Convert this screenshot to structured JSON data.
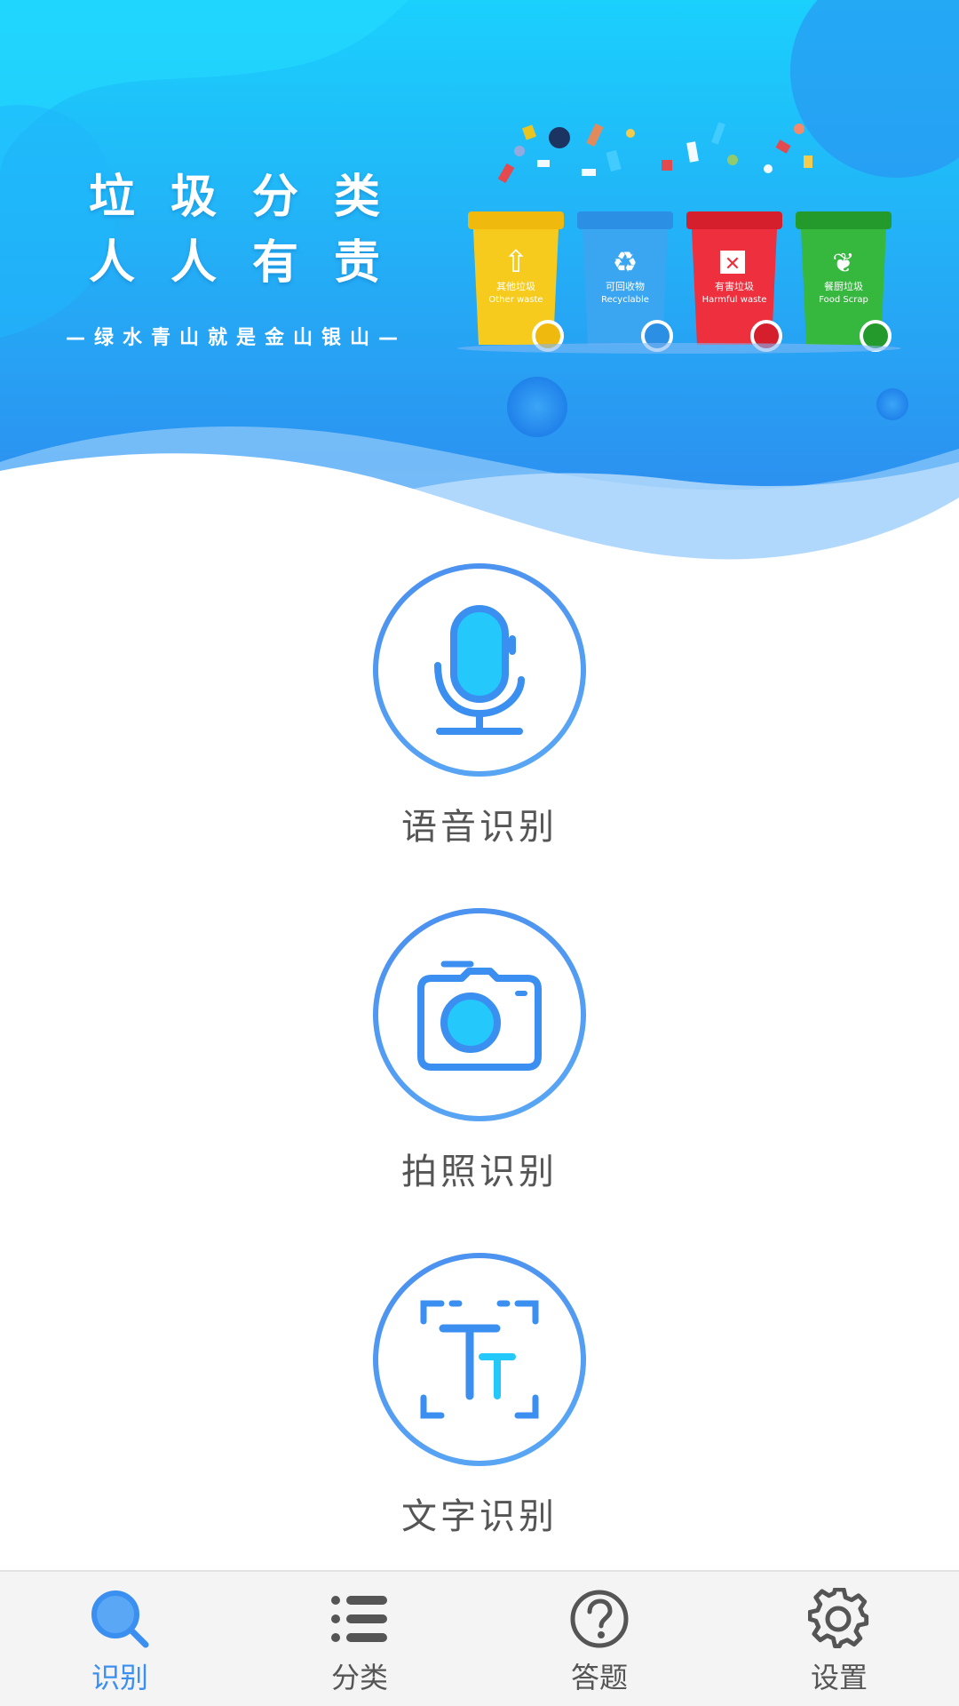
{
  "banner": {
    "slogan_line1": "垃圾分类",
    "slogan_line2": "人人有责",
    "tagline": "—绿水青山就是金山银山—",
    "bins": [
      {
        "cn": "其他垃圾",
        "en": "Other waste",
        "color": "#f5c518"
      },
      {
        "cn": "可回收物",
        "en": "Recyclable",
        "color": "#3aa0f0"
      },
      {
        "cn": "有害垃圾",
        "en": "Harmful waste",
        "color": "#ec2d3b"
      },
      {
        "cn": "餐厨垃圾",
        "en": "Food Scrap",
        "color": "#32b43a"
      }
    ]
  },
  "features": [
    {
      "label": "语音识别",
      "icon": "microphone-icon"
    },
    {
      "label": "拍照识别",
      "icon": "camera-icon"
    },
    {
      "label": "文字识别",
      "icon": "text-scan-icon"
    }
  ],
  "nav": {
    "items": [
      {
        "label": "识别",
        "icon": "search-icon",
        "active": true
      },
      {
        "label": "分类",
        "icon": "list-icon",
        "active": false
      },
      {
        "label": "答题",
        "icon": "question-icon",
        "active": false
      },
      {
        "label": "设置",
        "icon": "gear-icon",
        "active": false
      }
    ]
  },
  "colors": {
    "accent": "#3a8ff0",
    "banner_top": "#18c8fb",
    "banner_bottom": "#2f86ee",
    "nav_bg": "#f4f4f4",
    "text_gray": "#555555"
  }
}
